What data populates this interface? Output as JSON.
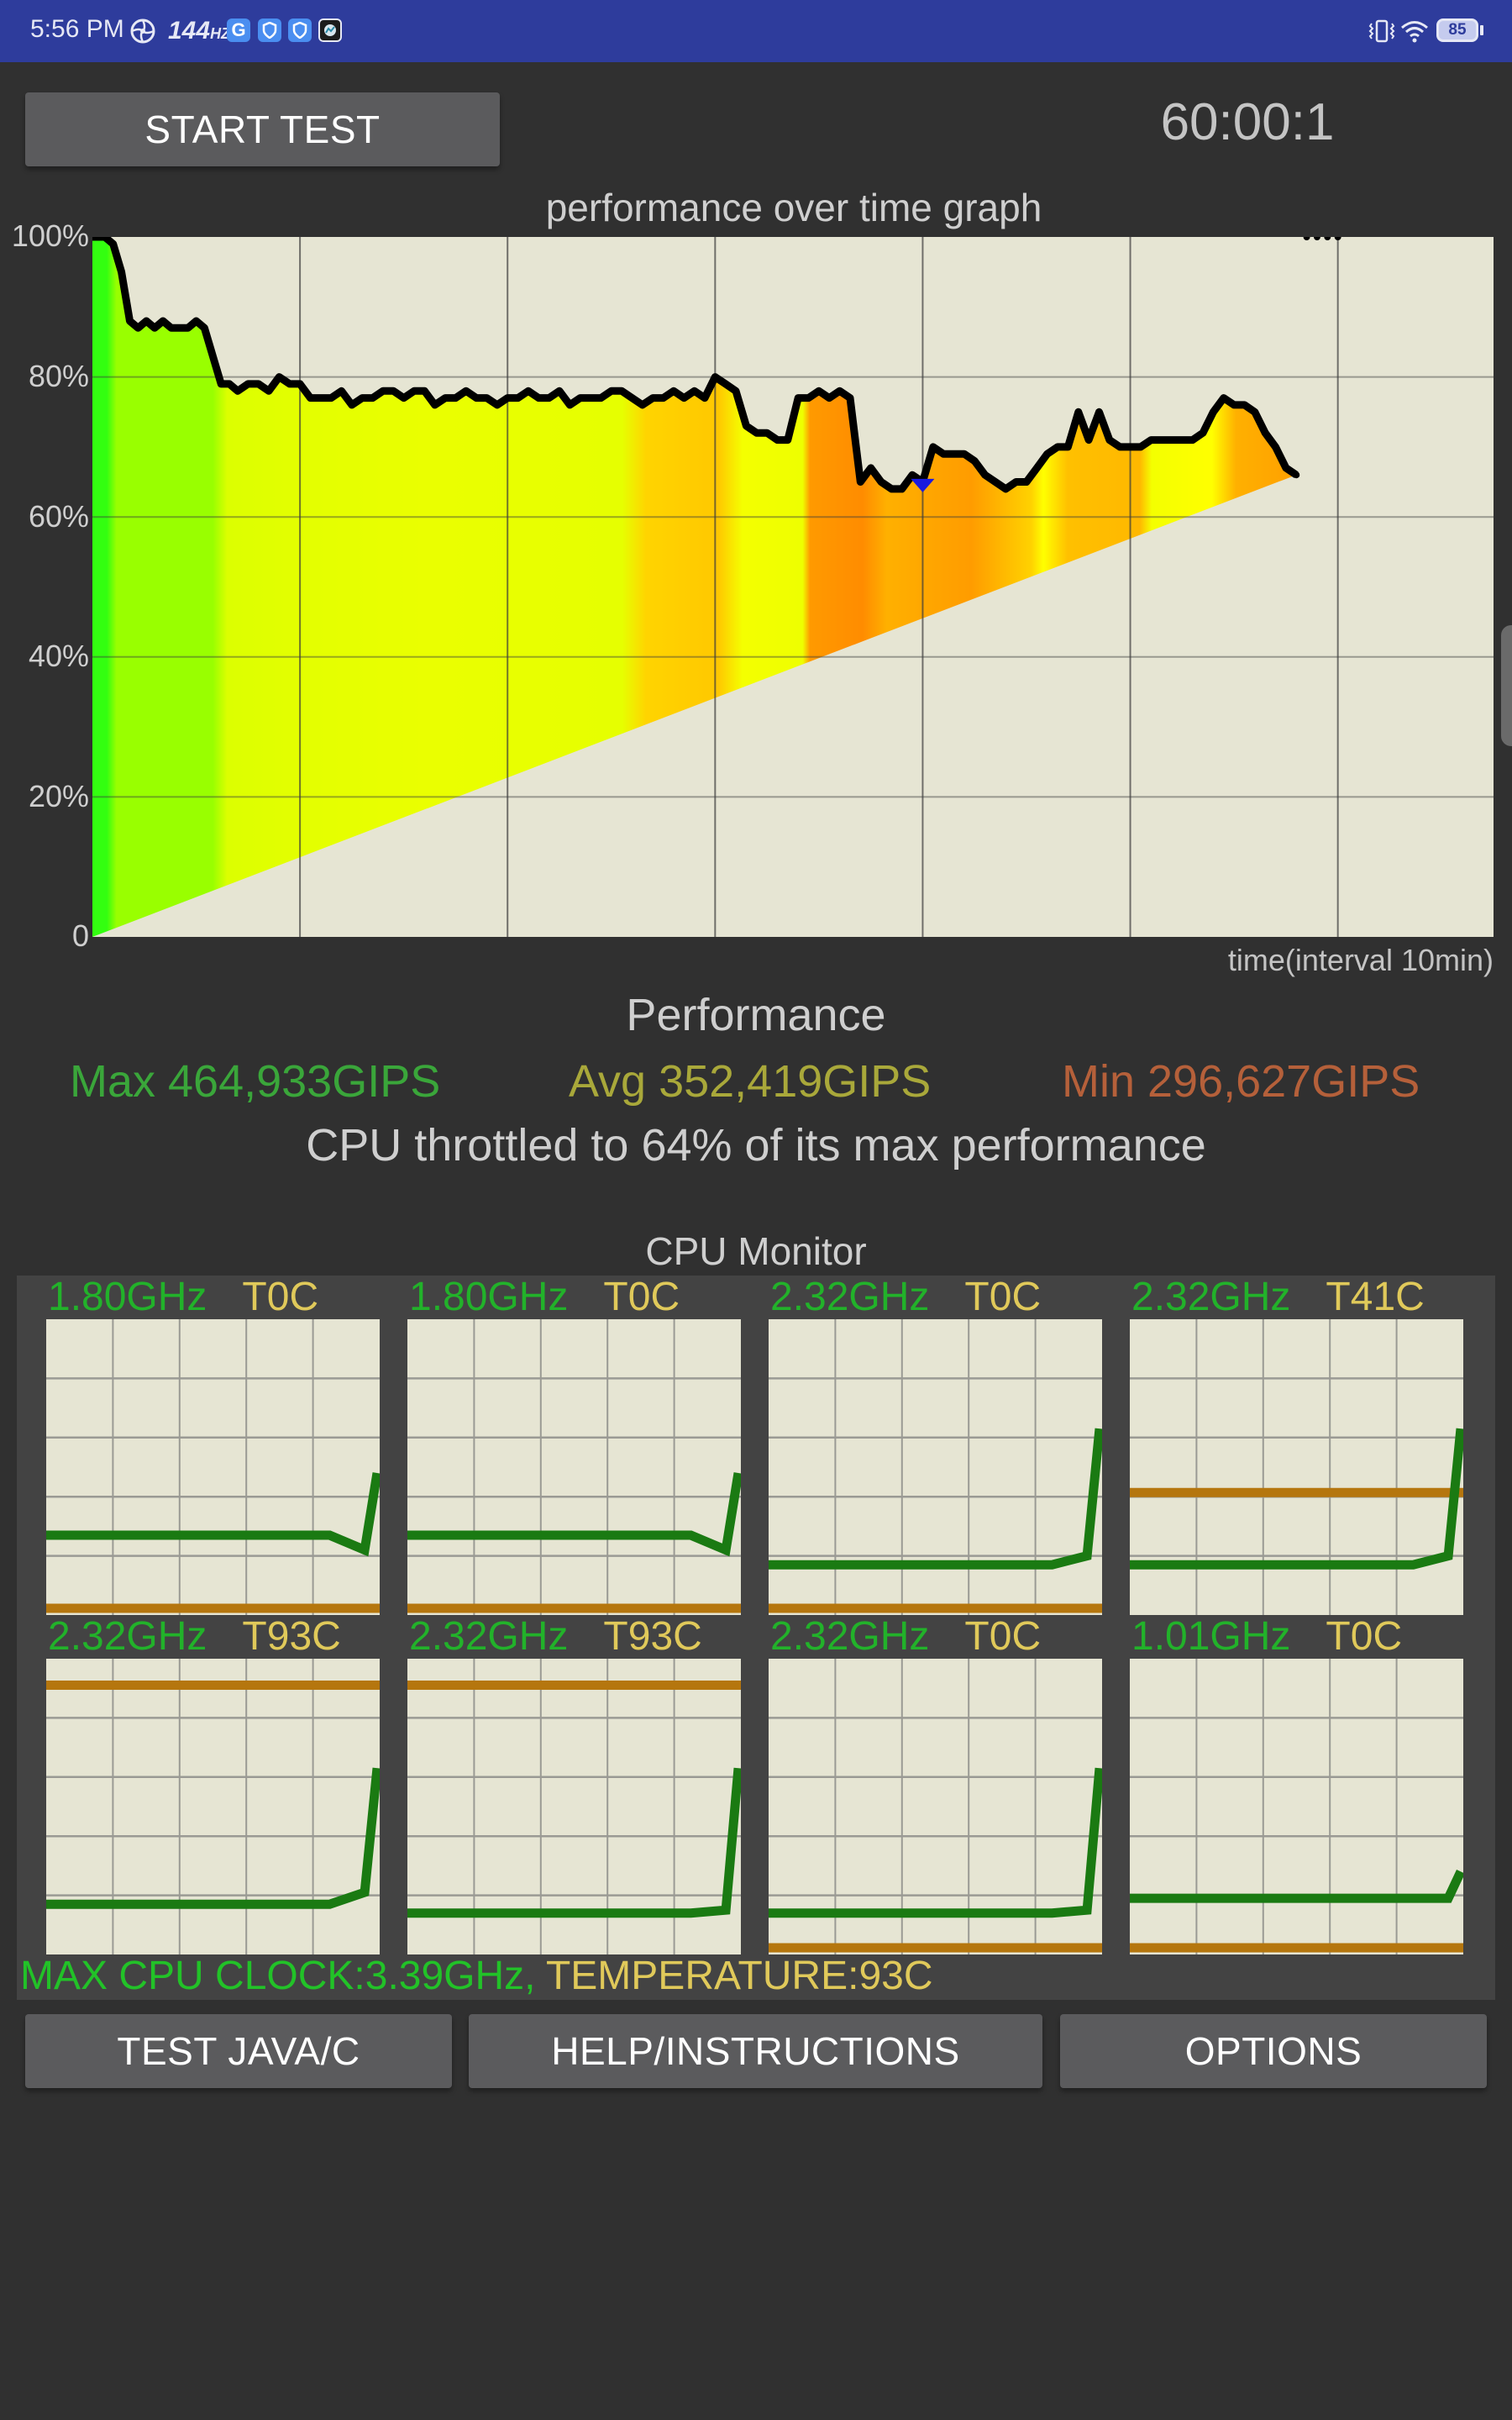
{
  "status_bar": {
    "time": "5:56 PM",
    "refresh_rate": "144",
    "refresh_unit": "HZ",
    "left_icons": [
      "fan-icon",
      "google-icon",
      "shield-icon",
      "shield-icon",
      "app-icon"
    ],
    "battery_level": "85",
    "right_icons": [
      "vibrate-icon",
      "wifi-icon",
      "battery-icon"
    ]
  },
  "toolbar": {
    "start_label": "START TEST",
    "timer": "60:00:1"
  },
  "graph": {
    "title": "performance over time graph",
    "x_label": "time(interval 10min)"
  },
  "chart_data": {
    "type": "area",
    "title": "performance over time graph",
    "xlabel": "time(interval 10min)",
    "ylabel": "",
    "ylim": [
      0,
      100
    ],
    "y_ticks": [
      "0",
      "20%",
      "40%",
      "60%",
      "80%",
      "100%"
    ],
    "x_grid_interval_min": 10,
    "x_range_min": [
      0,
      67.5
    ],
    "grid": true,
    "series": [
      {
        "name": "performance",
        "unit": "%",
        "x_min": [
          0,
          0.6,
          1,
          1.4,
          1.8,
          2.2,
          2.6,
          3,
          3.4,
          3.8,
          4.2,
          4.6,
          5,
          5.4,
          5.8,
          6.2,
          6.6,
          7,
          7.5,
          8,
          8.5,
          9,
          9.5,
          10,
          10.5,
          11,
          11.5,
          12,
          12.5,
          13,
          13.5,
          14,
          14.5,
          15,
          15.5,
          16,
          16.5,
          17,
          17.5,
          18,
          18.5,
          19,
          19.5,
          20,
          20.5,
          21,
          21.5,
          22,
          22.5,
          23,
          23.5,
          24,
          24.5,
          25,
          25.5,
          26,
          26.5,
          27,
          27.5,
          28,
          28.5,
          29,
          29.5,
          30,
          30.5,
          31,
          31.5,
          32,
          32.5,
          33,
          33.5,
          34,
          34.5,
          35,
          35.5,
          36,
          36.5,
          37,
          37.5,
          38,
          38.5,
          39,
          39.5,
          40,
          40.5,
          41,
          41.5,
          42,
          42.5,
          43,
          43.5,
          44,
          44.5,
          45,
          45.5,
          46,
          46.5,
          47,
          47.5,
          48,
          48.5,
          49,
          49.5,
          50,
          50.5,
          51,
          51.5,
          52,
          52.5,
          53,
          53.5,
          54,
          54.5,
          55,
          55.5,
          56,
          56.5,
          57,
          57.5,
          58,
          58.5,
          59,
          59.5,
          60
        ],
        "values": [
          100,
          100,
          99,
          95,
          88,
          87,
          88,
          87,
          88,
          87,
          87,
          87,
          88,
          87,
          83,
          79,
          79,
          78,
          79,
          79,
          78,
          80,
          79,
          79,
          77,
          77,
          77,
          78,
          76,
          77,
          77,
          78,
          78,
          77,
          78,
          78,
          76,
          77,
          77,
          78,
          77,
          77,
          76,
          77,
          77,
          78,
          77,
          77,
          78,
          76,
          77,
          77,
          77,
          78,
          78,
          77,
          76,
          77,
          77,
          78,
          77,
          78,
          77,
          80,
          79,
          78,
          73,
          72,
          72,
          71,
          71,
          77,
          77,
          78,
          77,
          78,
          77,
          65,
          67,
          65,
          64,
          64,
          66,
          65,
          70,
          69,
          69,
          69,
          68,
          66,
          65,
          64,
          65,
          65,
          67,
          69,
          70,
          70,
          75,
          71,
          75,
          71,
          70,
          70,
          70,
          71,
          71,
          71,
          71,
          71,
          72,
          75,
          77,
          76,
          76,
          75,
          72,
          70,
          67,
          66
        ],
        "min_marker_x_min": 40.0
      }
    ],
    "colorband_note": "area fill colored by performance: green (high) -> yellow -> orange (low)"
  },
  "performance": {
    "heading": "Performance",
    "max_label": "Max 464,933GIPS",
    "avg_label": "Avg 352,419GIPS",
    "min_label": "Min 296,627GIPS",
    "max_color": "#3aa63a",
    "avg_color": "#a9a83a",
    "min_color": "#b5603a",
    "throttle_text": "CPU throttled to 64% of its max performance"
  },
  "cpu_monitor": {
    "heading": "CPU Monitor",
    "cores": [
      {
        "freq": "1.80GHz",
        "temp": "T0C",
        "freq_trace": [
          0.27,
          0.27,
          0.27,
          0.27,
          0.27,
          0.22,
          0.48
        ],
        "temp_level": 0.0
      },
      {
        "freq": "1.80GHz",
        "temp": "T0C",
        "freq_trace": [
          0.27,
          0.27,
          0.27,
          0.27,
          0.27,
          0.22,
          0.48
        ],
        "temp_level": 0.0
      },
      {
        "freq": "2.32GHz",
        "temp": "T0C",
        "freq_trace": [
          0.17,
          0.17,
          0.17,
          0.17,
          0.17,
          0.2,
          0.63
        ],
        "temp_level": 0.0
      },
      {
        "freq": "2.32GHz",
        "temp": "T41C",
        "freq_trace": [
          0.17,
          0.17,
          0.17,
          0.17,
          0.17,
          0.2,
          0.63
        ],
        "temp_level": 0.41
      },
      {
        "freq": "2.32GHz",
        "temp": "T93C",
        "freq_trace": [
          0.17,
          0.17,
          0.17,
          0.17,
          0.17,
          0.21,
          0.63
        ],
        "temp_level": 0.93
      },
      {
        "freq": "2.32GHz",
        "temp": "T93C",
        "freq_trace": [
          0.14,
          0.14,
          0.14,
          0.14,
          0.14,
          0.15,
          0.63
        ],
        "temp_level": 0.93
      },
      {
        "freq": "2.32GHz",
        "temp": "T0C",
        "freq_trace": [
          0.14,
          0.14,
          0.14,
          0.14,
          0.14,
          0.15,
          0.63
        ],
        "temp_level": 0.0
      },
      {
        "freq": "1.01GHz",
        "temp": "T0C",
        "freq_trace": [
          0.19,
          0.19,
          0.19,
          0.19,
          0.19,
          0.19,
          0.28
        ],
        "temp_level": 0.0
      }
    ],
    "max_clock_text": "MAX CPU CLOCK:3.39GHz,",
    "temperature_text": "TEMPERATURE:93C",
    "freq_color": "#22b22a",
    "temp_color": "#e0c95a",
    "trace_color": "#1a7a12",
    "temp_line_color": "#b5760e"
  },
  "bottom_buttons": {
    "test_label": "TEST JAVA/C",
    "help_label": "HELP/INSTRUCTIONS",
    "options_label": "OPTIONS"
  }
}
